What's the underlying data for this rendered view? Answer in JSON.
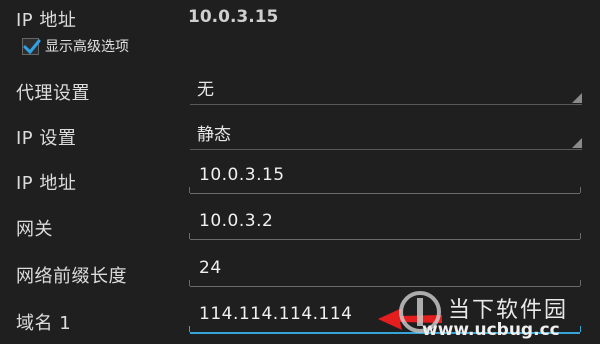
{
  "top": {
    "label": "IP 地址",
    "value": "10.0.3.15"
  },
  "advanced": {
    "label": "显示高级选项",
    "checked": true
  },
  "proxy": {
    "label": "代理设置",
    "value": "无"
  },
  "ip_settings": {
    "label": "IP 设置",
    "value": "静态"
  },
  "ip_address": {
    "label": "IP 地址",
    "value": "10.0.3.15"
  },
  "gateway": {
    "label": "网关",
    "value": "10.0.3.2"
  },
  "prefix_length": {
    "label": "网络前缀长度",
    "value": "24"
  },
  "dns1": {
    "label": "域名 1",
    "value": "114.114.114.114"
  },
  "watermark": {
    "brand": "当下软件园",
    "url": "www.ucbug.cc"
  },
  "colors": {
    "accent": "#35a4d6",
    "arrow": "#e41e1e",
    "background": "#1f1f1f"
  },
  "icons": {
    "checkbox": "checkmark-icon",
    "dropdown": "spinner-triangle-icon",
    "annotation": "red-arrow-icon"
  }
}
